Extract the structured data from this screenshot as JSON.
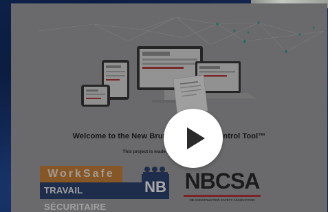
{
  "video": {
    "headline": "Welcome to the New Brunswick Silica Control Tool™",
    "subline": "This project is made possible by funding by",
    "play_icon": "play-icon"
  },
  "logos": {
    "worksafe": {
      "top": "WorkSafe",
      "bottom": "TRAVAIL SÉCURITAIRE",
      "badge": "NB"
    },
    "nbcsa": {
      "name": "NBCSA",
      "subtitle": "NB CONSTRUCTION SAFETY ASSOCIATION"
    }
  },
  "colors": {
    "page_background": "#0b1b3a",
    "worksafe_orange": "#c87a2c",
    "worksafe_navy": "#1f3866",
    "nbcsa_red": "#b8262b",
    "network_teal": "#2f9c8f"
  }
}
